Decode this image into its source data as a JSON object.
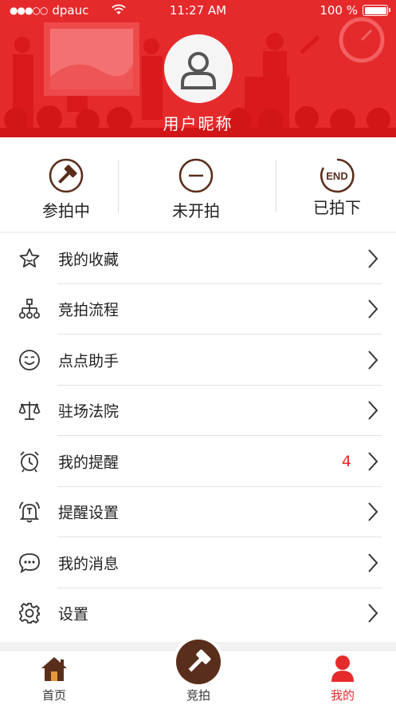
{
  "status_bar": {
    "carrier": "dpauc",
    "signal_dots": "●●●○○",
    "time": "11:27 AM",
    "battery": "100 %"
  },
  "profile": {
    "username": "用户昵称"
  },
  "status_tabs": [
    {
      "label": "参拍中",
      "icon": "gavel-icon"
    },
    {
      "label": "未开拍",
      "icon": "minus-circle-icon"
    },
    {
      "label": "已拍下",
      "icon": "end-icon",
      "icon_text": "END"
    }
  ],
  "menu": [
    {
      "label": "我的收藏",
      "icon": "star-icon"
    },
    {
      "label": "竞拍流程",
      "icon": "flowchart-icon"
    },
    {
      "label": "点点助手",
      "icon": "smiley-icon"
    },
    {
      "label": "驻场法院",
      "icon": "scales-icon"
    },
    {
      "label": "我的提醒",
      "icon": "alarm-clock-icon",
      "badge": "4"
    },
    {
      "label": "提醒设置",
      "icon": "bell-icon"
    },
    {
      "label": "我的消息",
      "icon": "chat-bubble-icon"
    },
    {
      "label": "设置",
      "icon": "gear-icon"
    }
  ],
  "tabbar": {
    "home": "首页",
    "auction": "竞拍",
    "me": "我的"
  },
  "colors": {
    "brand_red": "#e52a2c",
    "brand_brown": "#5a2e1c"
  }
}
